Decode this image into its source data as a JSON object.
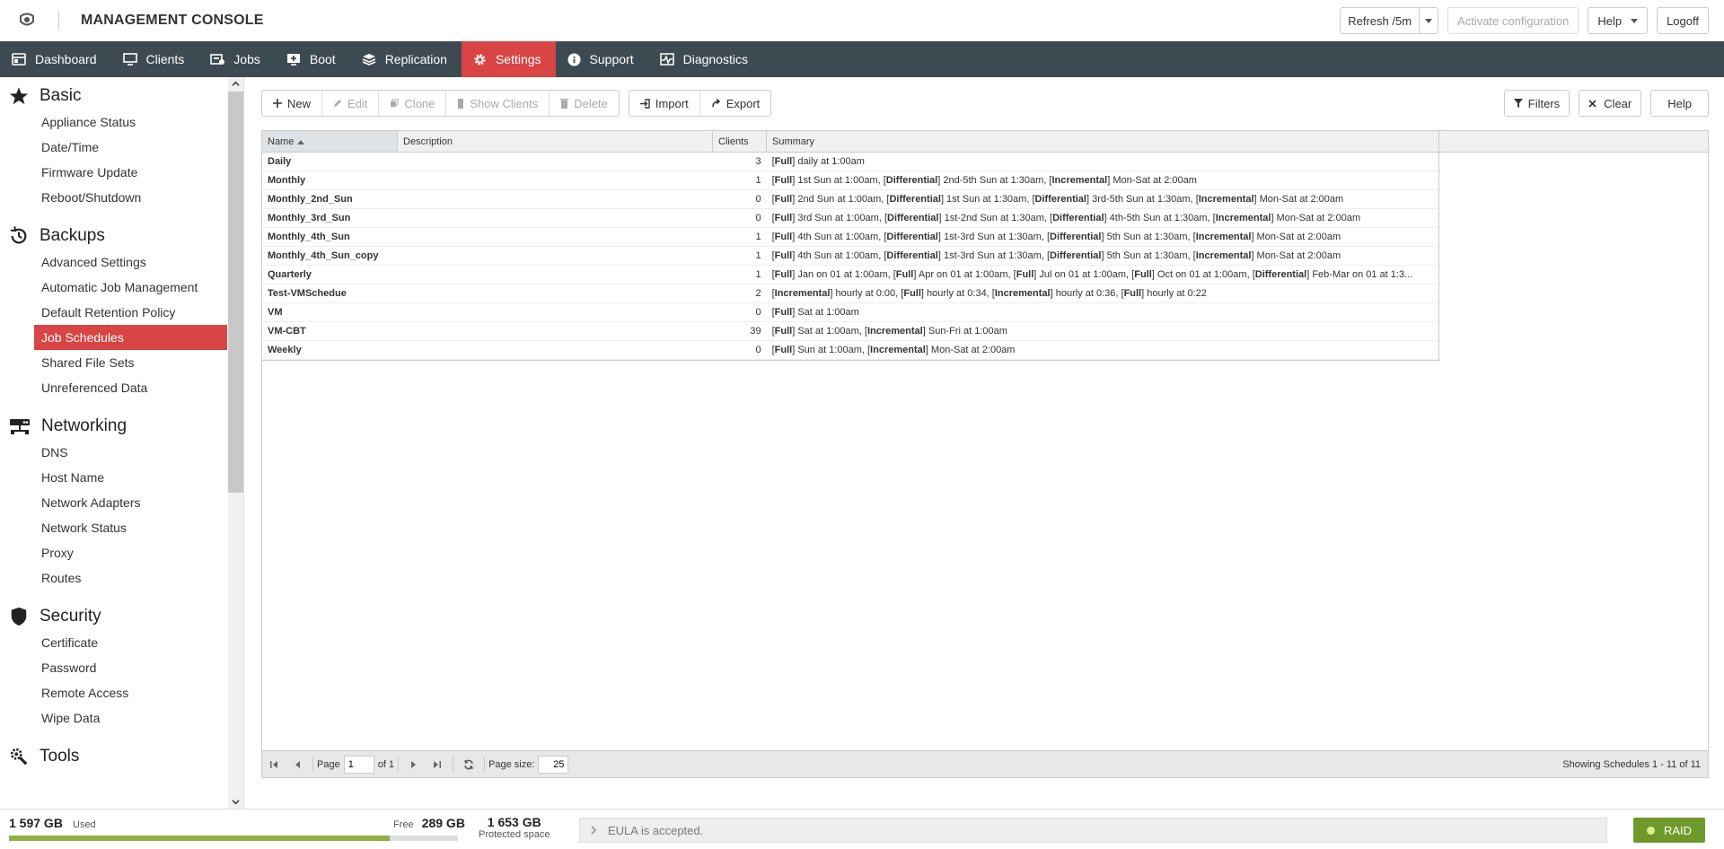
{
  "app": {
    "title": "MANAGEMENT CONSOLE"
  },
  "top_actions": {
    "refresh": "Refresh /5m",
    "activate": "Activate configuration",
    "help": "Help",
    "logoff": "Logoff"
  },
  "nav": [
    {
      "label": "Dashboard",
      "icon": "dashboard-icon"
    },
    {
      "label": "Clients",
      "icon": "monitor-icon"
    },
    {
      "label": "Jobs",
      "icon": "jobs-icon"
    },
    {
      "label": "Boot",
      "icon": "boot-icon"
    },
    {
      "label": "Replication",
      "icon": "replication-icon"
    },
    {
      "label": "Settings",
      "icon": "gear-icon",
      "active": true
    },
    {
      "label": "Support",
      "icon": "info-icon"
    },
    {
      "label": "Diagnostics",
      "icon": "diagnostics-icon"
    }
  ],
  "sidebar": {
    "sections": [
      {
        "title": "Basic",
        "icon": "star-icon",
        "items": [
          "Appliance Status",
          "Date/Time",
          "Firmware Update",
          "Reboot/Shutdown"
        ]
      },
      {
        "title": "Backups",
        "icon": "history-icon",
        "items": [
          "Advanced Settings",
          "Automatic Job Management",
          "Default Retention Policy",
          "Job Schedules",
          "Shared File Sets",
          "Unreferenced Data"
        ],
        "active_item": "Job Schedules"
      },
      {
        "title": "Networking",
        "icon": "network-icon",
        "items": [
          "DNS",
          "Host Name",
          "Network Adapters",
          "Network Status",
          "Proxy",
          "Routes"
        ]
      },
      {
        "title": "Security",
        "icon": "shield-icon",
        "items": [
          "Certificate",
          "Password",
          "Remote Access",
          "Wipe Data"
        ]
      },
      {
        "title": "Tools",
        "icon": "tools-icon",
        "items": []
      }
    ]
  },
  "toolbar": {
    "new": "New",
    "edit": "Edit",
    "clone": "Clone",
    "show_clients": "Show Clients",
    "delete": "Delete",
    "import": "Import",
    "export": "Export",
    "filters": "Filters",
    "clear": "Clear",
    "help": "Help"
  },
  "grid": {
    "columns": [
      "Name",
      "Description",
      "Clients",
      "Summary"
    ],
    "rows": [
      {
        "name": "Daily",
        "description": "",
        "clients": "3",
        "summary": [
          [
            "Full",
            " daily at 1:00am"
          ]
        ]
      },
      {
        "name": "Monthly",
        "description": "",
        "clients": "1",
        "summary": [
          [
            "Full",
            " 1st Sun at 1:00am, "
          ],
          [
            "Differential",
            " 2nd-5th Sun at 1:30am, "
          ],
          [
            "Incremental",
            " Mon-Sat at 2:00am"
          ]
        ]
      },
      {
        "name": "Monthly_2nd_Sun",
        "description": "",
        "clients": "0",
        "summary": [
          [
            "Full",
            " 2nd Sun at 1:00am, "
          ],
          [
            "Differential",
            " 1st Sun at 1:30am, "
          ],
          [
            "Differential",
            " 3rd-5th Sun at 1:30am, "
          ],
          [
            "Incremental",
            " Mon-Sat at 2:00am"
          ]
        ]
      },
      {
        "name": "Monthly_3rd_Sun",
        "description": "",
        "clients": "0",
        "summary": [
          [
            "Full",
            " 3rd Sun at 1:00am, "
          ],
          [
            "Differential",
            " 1st-2nd Sun at 1:30am, "
          ],
          [
            "Differential",
            " 4th-5th Sun at 1:30am, "
          ],
          [
            "Incremental",
            " Mon-Sat at 2:00am"
          ]
        ]
      },
      {
        "name": "Monthly_4th_Sun",
        "description": "",
        "clients": "1",
        "summary": [
          [
            "Full",
            " 4th Sun at 1:00am, "
          ],
          [
            "Differential",
            " 1st-3rd Sun at 1:30am, "
          ],
          [
            "Differential",
            " 5th Sun at 1:30am, "
          ],
          [
            "Incremental",
            " Mon-Sat at 2:00am"
          ]
        ]
      },
      {
        "name": "Monthly_4th_Sun_copy",
        "description": "",
        "clients": "1",
        "summary": [
          [
            "Full",
            " 4th Sun at 1:00am, "
          ],
          [
            "Differential",
            " 1st-3rd Sun at 1:30am, "
          ],
          [
            "Differential",
            " 5th Sun at 1:30am, "
          ],
          [
            "Incremental",
            " Mon-Sat at 2:00am"
          ]
        ]
      },
      {
        "name": "Quarterly",
        "description": "",
        "clients": "1",
        "summary": [
          [
            "Full",
            " Jan on 01 at 1:00am, "
          ],
          [
            "Full",
            " Apr on 01 at 1:00am, "
          ],
          [
            "Full",
            " Jul on 01 at 1:00am, "
          ],
          [
            "Full",
            " Oct on 01 at 1:00am, "
          ],
          [
            "Differential",
            " Feb-Mar on 01 at 1:3..."
          ]
        ]
      },
      {
        "name": "Test-VMSchedue",
        "description": "",
        "clients": "2",
        "summary": [
          [
            "Incremental",
            " hourly at 0:00, "
          ],
          [
            "Full",
            " hourly at 0:34, "
          ],
          [
            "Incremental",
            " hourly at 0:36, "
          ],
          [
            "Full",
            " hourly at 0:22"
          ]
        ]
      },
      {
        "name": "VM",
        "description": "",
        "clients": "0",
        "summary": [
          [
            "Full",
            " Sat at 1:00am"
          ]
        ]
      },
      {
        "name": "VM-CBT",
        "description": "",
        "clients": "39",
        "summary": [
          [
            "Full",
            " Sat at 1:00am, "
          ],
          [
            "Incremental",
            " Sun-Fri at 1:00am"
          ]
        ]
      },
      {
        "name": "Weekly",
        "description": "",
        "clients": "0",
        "summary": [
          [
            "Full",
            " Sun at 1:00am, "
          ],
          [
            "Incremental",
            " Mon-Sat at 2:00am"
          ]
        ]
      }
    ]
  },
  "pager": {
    "page_label": "Page",
    "page": "1",
    "of": "of 1",
    "size_label": "Page size:",
    "size": "25",
    "status": "Showing Schedules 1 - 11 of 11"
  },
  "footer": {
    "used_value": "1 597 GB",
    "used_label": "Used",
    "free_label": "Free",
    "free_value": "289 GB",
    "used_fraction": 0.847,
    "protected_value": "1 653 GB",
    "protected_label": "Protected space",
    "eula": "EULA is accepted.",
    "raid": "RAID",
    "raid_color": "#6f9a2b"
  }
}
